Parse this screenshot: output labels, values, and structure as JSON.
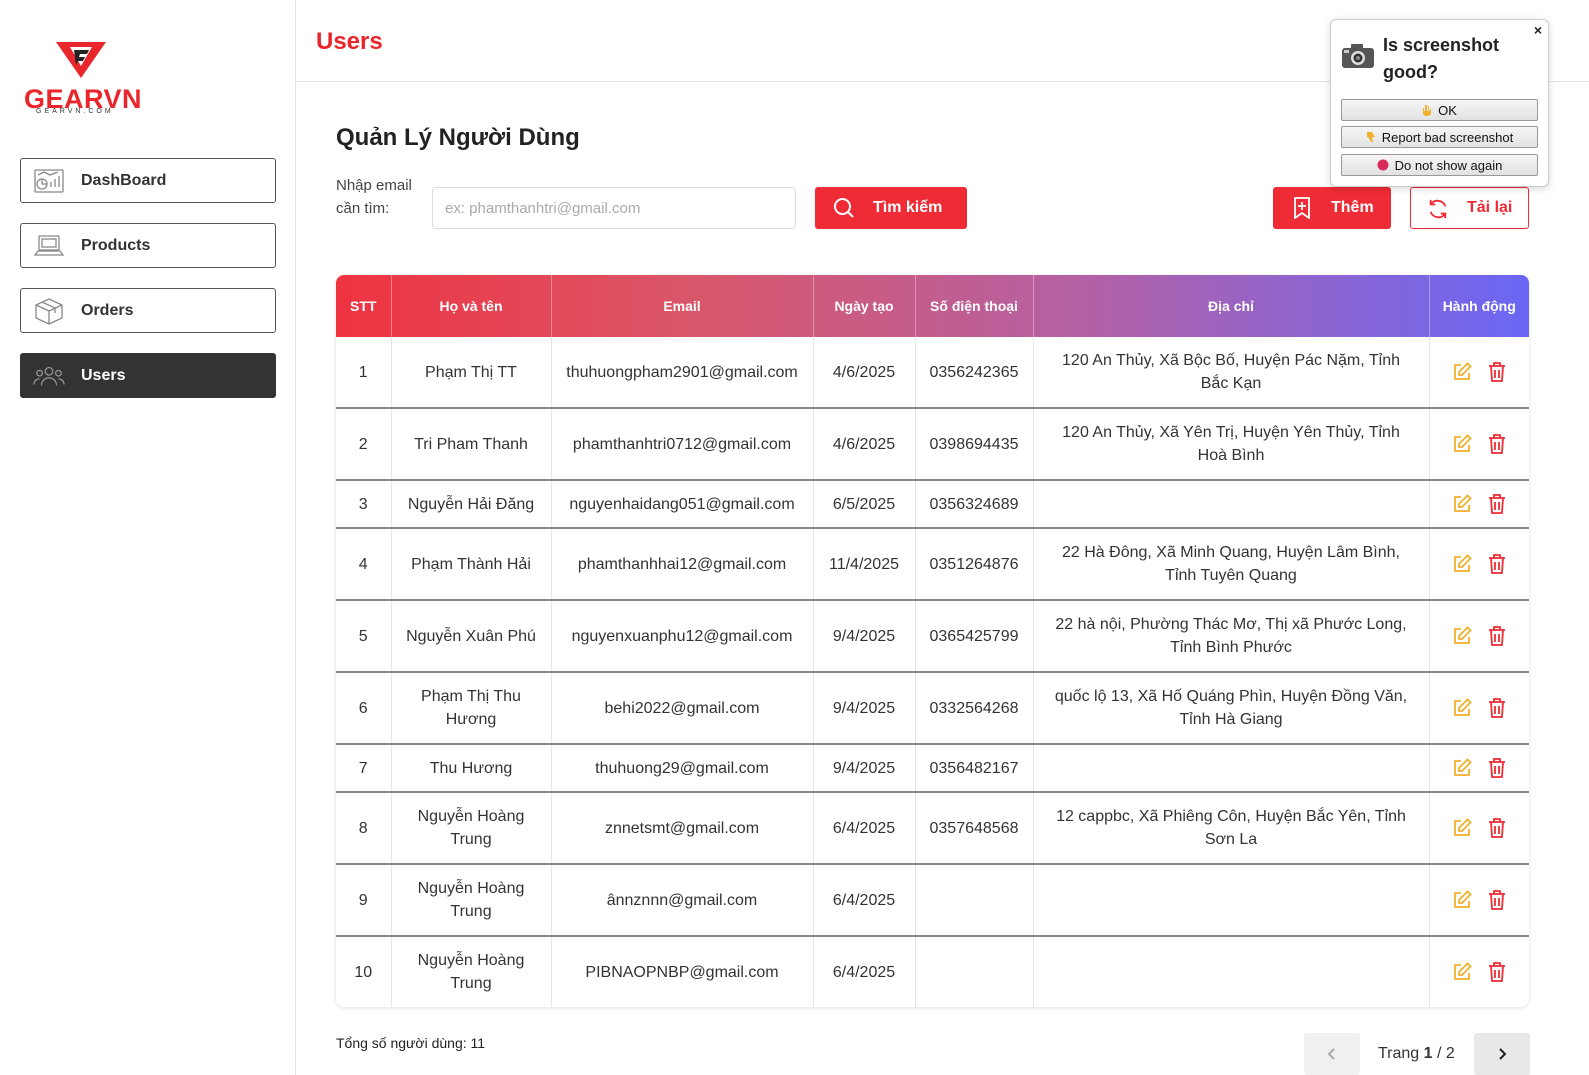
{
  "brand": {
    "name": "GEARVN",
    "domain": "GEARVN.COM",
    "accent": "#ef2b35"
  },
  "sidebar": {
    "items": [
      {
        "label": "DashBoard",
        "icon": "dashboard-icon"
      },
      {
        "label": "Products",
        "icon": "laptop-icon"
      },
      {
        "label": "Orders",
        "icon": "box-icon"
      },
      {
        "label": "Users",
        "icon": "users-icon",
        "active": true
      }
    ]
  },
  "header": {
    "title": "Users"
  },
  "main": {
    "heading": "Quản Lý Người Dùng",
    "search": {
      "label": "Nhập email cần tìm:",
      "placeholder": "ex: phamthanhtri@gmail.com",
      "value": "",
      "button": "Tìm kiếm"
    },
    "add_button": "Thêm",
    "reload_button": "Tải lại"
  },
  "table": {
    "headers": [
      "STT",
      "Họ và tên",
      "Email",
      "Ngày tạo",
      "Số điện thoại",
      "Địa chỉ",
      "Hành động"
    ],
    "rows": [
      {
        "stt": "1",
        "name": "Phạm Thị TT",
        "email": "thuhuongpham2901@gmail.com",
        "date": "4/6/2025",
        "phone": "0356242365",
        "address": "120 An Thủy, Xã Bộc Bố, Huyện Pác Nặm, Tỉnh Bắc Kạn"
      },
      {
        "stt": "2",
        "name": "Tri Pham Thanh",
        "email": "phamthanhtri0712@gmail.com",
        "date": "4/6/2025",
        "phone": "0398694435",
        "address": "120 An Thủy, Xã Yên Trị, Huyện Yên Thủy, Tỉnh Hoà Bình"
      },
      {
        "stt": "3",
        "name": "Nguyễn Hải Đăng",
        "email": "nguyenhaidang051@gmail.com",
        "date": "6/5/2025",
        "phone": "0356324689",
        "address": ""
      },
      {
        "stt": "4",
        "name": "Phạm Thành Hải",
        "email": "phamthanhhai12@gmail.com",
        "date": "11/4/2025",
        "phone": "0351264876",
        "address": "22 Hà Đông, Xã Minh Quang, Huyện Lâm Bình, Tỉnh Tuyên Quang"
      },
      {
        "stt": "5",
        "name": "Nguyễn Xuân Phú",
        "email": "nguyenxuanphu12@gmail.com",
        "date": "9/4/2025",
        "phone": "0365425799",
        "address": "22 hà nội, Phường Thác Mơ, Thị xã Phước Long, Tỉnh Bình Phước"
      },
      {
        "stt": "6",
        "name": "Phạm Thị Thu Hương",
        "email": "behi2022@gmail.com",
        "date": "9/4/2025",
        "phone": "0332564268",
        "address": "quốc lộ 13, Xã Hố Quáng Phìn, Huyện Đồng Văn, Tỉnh Hà Giang"
      },
      {
        "stt": "7",
        "name": "Thu Hương",
        "email": "thuhuong29@gmail.com",
        "date": "9/4/2025",
        "phone": "0356482167",
        "address": ""
      },
      {
        "stt": "8",
        "name": "Nguyễn Hoàng Trung",
        "email": "znnetsmt@gmail.com",
        "date": "6/4/2025",
        "phone": "0357648568",
        "address": "12 cappbc, Xã Phiêng Côn, Huyện Bắc Yên, Tỉnh Sơn La"
      },
      {
        "stt": "9",
        "name": "Nguyễn Hoàng Trung",
        "email": "ânnznnn@gmail.com",
        "date": "6/4/2025",
        "phone": "",
        "address": ""
      },
      {
        "stt": "10",
        "name": "Nguyễn Hoàng Trung",
        "email": "PIBNAOPNBP@gmail.com",
        "date": "6/4/2025",
        "phone": "",
        "address": ""
      }
    ]
  },
  "footer": {
    "total_label": "Tổng số người dùng: 11",
    "page_prefix": "Trang",
    "page_current": "1",
    "page_sep": "/",
    "page_total": "2"
  },
  "popup": {
    "title": "Is screenshot good?",
    "close": "×",
    "ok": "OK",
    "report": "Report bad screenshot",
    "hide": "Do not show again"
  }
}
